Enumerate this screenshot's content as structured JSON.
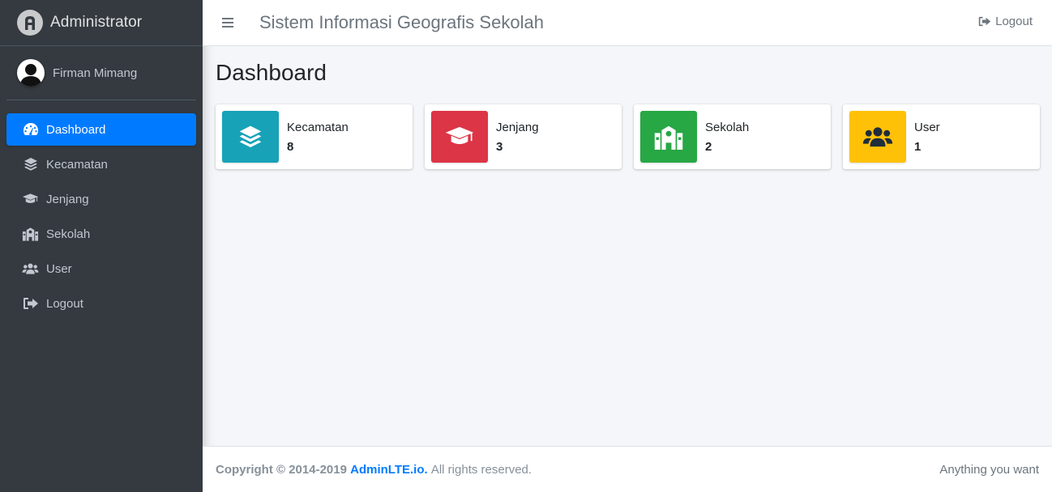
{
  "brand": {
    "name": "Administrator",
    "logo_icon": "adminlte-logo-icon"
  },
  "user": {
    "name": "Firman Mimang",
    "avatar_icon": "user-avatar-icon"
  },
  "sidebar": {
    "items": [
      {
        "label": "Dashboard",
        "icon": "tachometer-icon",
        "active": true
      },
      {
        "label": "Kecamatan",
        "icon": "layer-group-icon",
        "active": false
      },
      {
        "label": "Jenjang",
        "icon": "graduation-cap-icon",
        "active": false
      },
      {
        "label": "Sekolah",
        "icon": "school-icon",
        "active": false
      },
      {
        "label": "User",
        "icon": "users-icon",
        "active": false
      },
      {
        "label": "Logout",
        "icon": "sign-out-icon",
        "active": false
      }
    ]
  },
  "navbar": {
    "title": "Sistem Informasi Geografis Sekolah",
    "logout_label": "Logout"
  },
  "page": {
    "title": "Dashboard"
  },
  "info_boxes": [
    {
      "label": "Kecamatan",
      "value": "8",
      "color": "#17a2b8",
      "icon": "layer-group-icon"
    },
    {
      "label": "Jenjang",
      "value": "3",
      "color": "#dc3545",
      "icon": "graduation-cap-icon"
    },
    {
      "label": "Sekolah",
      "value": "2",
      "color": "#28a745",
      "icon": "school-icon"
    },
    {
      "label": "User",
      "value": "1",
      "color": "#ffc107",
      "icon": "users-icon"
    }
  ],
  "footer": {
    "copyright": "Copyright © 2014-2019",
    "link_text": "AdminLTE.io.",
    "rights": "All rights reserved.",
    "right_text": "Anything you want"
  },
  "colors": {
    "primary": "#007bff",
    "sidebar_bg": "#343a40",
    "content_bg": "#f4f6f9"
  }
}
